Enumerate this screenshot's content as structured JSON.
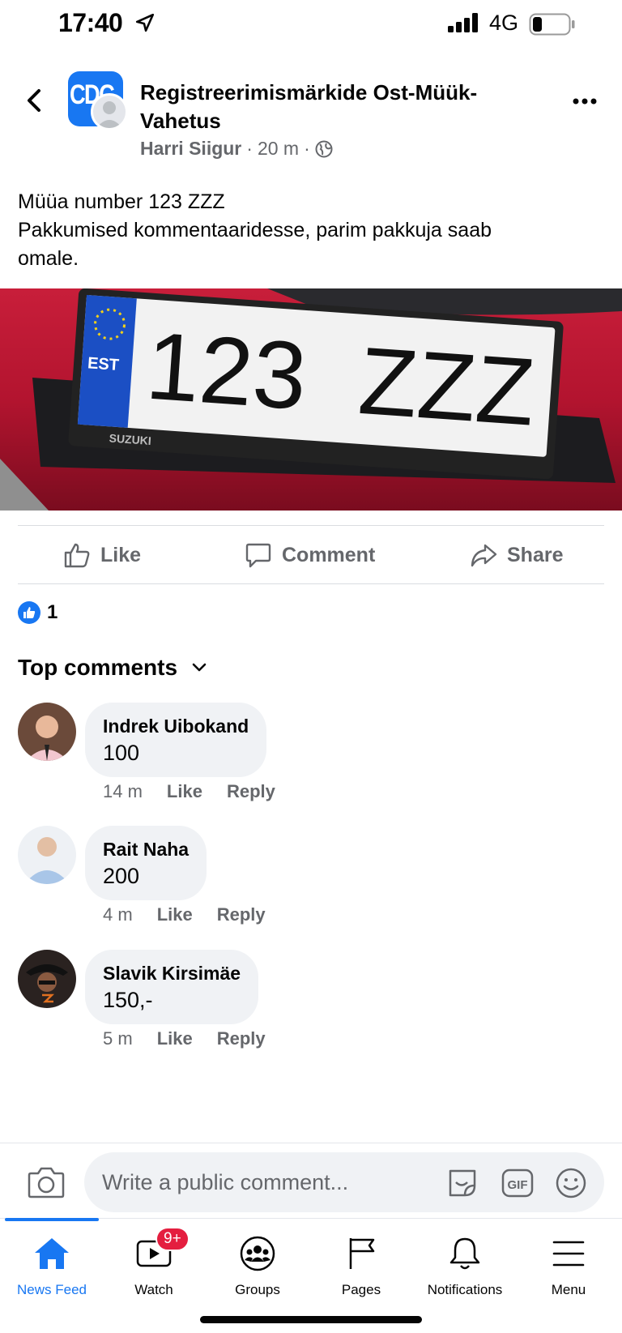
{
  "status_bar": {
    "time": "17:40",
    "network": "4G"
  },
  "post": {
    "group_name": "Registreerimismärkide Ost-Müük-Vahetus",
    "author": "Harri Siigur",
    "time": "20 m",
    "separator": "·",
    "text_lines": [
      "Müüa number 123 ZZZ",
      "Pakkumised kommentaaridesse, parim pakkuja saab",
      "omale."
    ],
    "group_logo_text": "CDC"
  },
  "photo": {
    "plate_country": "EST",
    "plate_number": "123  ZZZ",
    "frame_text": "SUZUKI"
  },
  "actions": {
    "like": "Like",
    "comment": "Comment",
    "share": "Share"
  },
  "reactions": {
    "count": "1"
  },
  "comments_header": "Top comments",
  "comments": [
    {
      "name": "Indrek Uibokand",
      "text": "100",
      "time": "14 m",
      "like": "Like",
      "reply": "Reply"
    },
    {
      "name": "Rait Naha",
      "text": "200",
      "time": "4 m",
      "like": "Like",
      "reply": "Reply"
    },
    {
      "name": "Slavik Kirsimäe",
      "text": "150,-",
      "time": "5 m",
      "like": "Like",
      "reply": "Reply"
    }
  ],
  "composer": {
    "placeholder": "Write a public comment..."
  },
  "tabs": [
    {
      "label": "News Feed",
      "icon": "home-icon"
    },
    {
      "label": "Watch",
      "icon": "watch-icon",
      "badge": "9+"
    },
    {
      "label": "Groups",
      "icon": "groups-icon"
    },
    {
      "label": "Pages",
      "icon": "flag-icon"
    },
    {
      "label": "Notifications",
      "icon": "bell-icon"
    },
    {
      "label": "Menu",
      "icon": "menu-icon"
    }
  ],
  "colors": {
    "accent": "#1877f2",
    "secondary_text": "#65676b",
    "bubble": "#f0f2f5",
    "badge": "#e41e3f"
  }
}
